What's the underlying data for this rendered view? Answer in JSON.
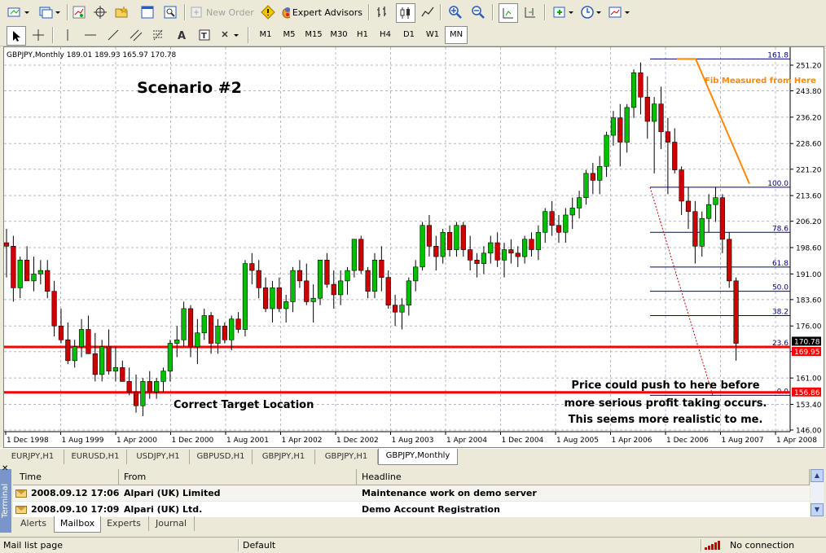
{
  "toolbar": {
    "new_order_label": "New Order",
    "expert_advisors_label": "Expert Advisors"
  },
  "timeframes": [
    "M1",
    "M5",
    "M15",
    "M30",
    "H1",
    "H4",
    "D1",
    "W1",
    "MN"
  ],
  "active_timeframe": "MN",
  "chart": {
    "header": "GBPJPY,Monthly  189.01 189.93 165.97 170.78",
    "annotation_title": "Scenario #2",
    "annotation_target": "Correct Target Location",
    "annotation_fib": "Fib Measured from Here",
    "annotation_note_1": "Price could push to here before",
    "annotation_note_2": "more serious profit taking occurs.",
    "annotation_note_3": "This seems more realistic to me.",
    "colors": {
      "bull": "#00c000",
      "bear": "#d00000",
      "fib": "#000080",
      "trend": "#ff8800",
      "hline": "#ff0000",
      "grid": "#b0b8c8"
    }
  },
  "chart_data": {
    "type": "candlestick",
    "symbol": "GBPJPY",
    "timeframe": "Monthly",
    "ohlc_header": {
      "open": 189.01,
      "high": 189.93,
      "low": 165.97,
      "close": 170.78
    },
    "y_ticks": [
      251.2,
      243.8,
      236.2,
      228.6,
      221.2,
      213.6,
      206.2,
      198.6,
      191.0,
      183.6,
      176.0,
      168.6,
      161.0,
      153.4,
      146.0
    ],
    "ylim": [
      146.0,
      251.2
    ],
    "x_ticks": [
      "1 Dec 1998",
      "1 Aug 1999",
      "1 Apr 2000",
      "1 Dec 2000",
      "1 Aug 2001",
      "1 Apr 2002",
      "1 Dec 2002",
      "1 Aug 2003",
      "1 Apr 2004",
      "1 Dec 2004",
      "1 Aug 2005",
      "1 Apr 2006",
      "1 Dec 2006",
      "1 Aug 2007",
      "1 Apr 2008"
    ],
    "fib_levels": [
      {
        "label": "161.8",
        "price": 253.0
      },
      {
        "label": "100.0",
        "price": 216.0
      },
      {
        "label": "78.6",
        "price": 203.0
      },
      {
        "label": "61.8",
        "price": 193.0
      },
      {
        "label": "50.0",
        "price": 186.0
      },
      {
        "label": "38.2",
        "price": 179.0
      },
      {
        "label": "23.6",
        "price": 170.0
      },
      {
        "label": "0.0",
        "price": 156.0
      }
    ],
    "horizontal_lines": [
      {
        "price": 170.78,
        "label": "170.78"
      },
      {
        "price": 169.95,
        "label": "169.95"
      },
      {
        "price": 156.86,
        "label": "156.86"
      }
    ],
    "candles": [
      [
        200,
        204,
        190,
        199
      ],
      [
        199,
        202,
        183,
        187
      ],
      [
        187,
        196,
        184,
        195
      ],
      [
        195,
        199,
        189,
        189
      ],
      [
        189,
        196,
        186,
        191
      ],
      [
        191,
        195,
        188,
        192
      ],
      [
        192,
        195,
        184,
        186
      ],
      [
        186,
        189,
        173,
        176
      ],
      [
        176,
        181,
        171,
        172
      ],
      [
        172,
        177,
        165,
        166
      ],
      [
        166,
        172,
        164,
        170
      ],
      [
        170,
        178,
        167,
        175
      ],
      [
        175,
        179,
        168,
        168
      ],
      [
        168,
        174,
        160,
        162
      ],
      [
        162,
        172,
        160,
        170
      ],
      [
        170,
        175,
        162,
        163
      ],
      [
        163,
        170,
        160,
        164
      ],
      [
        164,
        166,
        160,
        160
      ],
      [
        160,
        164,
        156,
        157
      ],
      [
        157,
        162,
        151,
        153
      ],
      [
        153,
        161,
        150,
        160
      ],
      [
        160,
        163,
        155,
        157
      ],
      [
        157,
        161,
        155,
        160
      ],
      [
        160,
        164,
        157,
        163
      ],
      [
        163,
        172,
        160,
        171
      ],
      [
        171,
        176,
        167,
        172
      ],
      [
        172,
        183,
        170,
        181
      ],
      [
        181,
        182,
        167,
        170
      ],
      [
        170,
        178,
        165,
        174
      ],
      [
        174,
        181,
        172,
        179
      ],
      [
        179,
        180,
        168,
        171
      ],
      [
        171,
        178,
        168,
        176
      ],
      [
        176,
        177,
        171,
        172
      ],
      [
        172,
        179,
        169,
        178
      ],
      [
        178,
        180,
        174,
        175
      ],
      [
        175,
        195,
        173,
        194
      ],
      [
        194,
        197,
        188,
        192
      ],
      [
        192,
        195,
        184,
        187
      ],
      [
        187,
        190,
        180,
        181
      ],
      [
        181,
        189,
        177,
        187
      ],
      [
        187,
        190,
        180,
        181
      ],
      [
        181,
        185,
        177,
        183
      ],
      [
        183,
        193,
        180,
        192
      ],
      [
        192,
        195,
        187,
        189
      ],
      [
        189,
        194,
        182,
        183
      ],
      [
        183,
        188,
        177,
        184
      ],
      [
        184,
        195,
        182,
        195
      ],
      [
        195,
        197,
        187,
        188
      ],
      [
        188,
        192,
        181,
        185
      ],
      [
        185,
        192,
        182,
        189
      ],
      [
        189,
        193,
        185,
        192
      ],
      [
        192,
        201,
        190,
        201
      ],
      [
        201,
        202,
        191,
        192
      ],
      [
        192,
        193,
        184,
        186
      ],
      [
        186,
        197,
        184,
        195
      ],
      [
        195,
        199,
        186,
        190
      ],
      [
        190,
        192,
        181,
        182
      ],
      [
        182,
        185,
        176,
        180
      ],
      [
        180,
        184,
        175,
        182
      ],
      [
        182,
        190,
        179,
        189
      ],
      [
        189,
        195,
        186,
        193
      ],
      [
        193,
        206,
        192,
        205
      ],
      [
        205,
        208,
        196,
        199
      ],
      [
        199,
        202,
        192,
        196
      ],
      [
        196,
        204,
        194,
        203
      ],
      [
        203,
        205,
        196,
        198
      ],
      [
        198,
        206,
        196,
        205
      ],
      [
        205,
        206,
        196,
        198
      ],
      [
        198,
        202,
        192,
        195
      ],
      [
        195,
        197,
        190,
        194
      ],
      [
        194,
        199,
        191,
        197
      ],
      [
        197,
        202,
        194,
        200
      ],
      [
        200,
        203,
        193,
        195
      ],
      [
        195,
        200,
        190,
        198
      ],
      [
        198,
        201,
        194,
        197
      ],
      [
        197,
        199,
        193,
        196
      ],
      [
        196,
        202,
        194,
        201
      ],
      [
        201,
        203,
        196,
        198
      ],
      [
        198,
        205,
        195,
        203
      ],
      [
        203,
        210,
        200,
        209
      ],
      [
        209,
        212,
        202,
        205
      ],
      [
        205,
        208,
        200,
        203
      ],
      [
        203,
        210,
        200,
        208
      ],
      [
        208,
        213,
        204,
        210
      ],
      [
        210,
        215,
        207,
        213
      ],
      [
        213,
        221,
        211,
        220
      ],
      [
        220,
        223,
        214,
        218
      ],
      [
        218,
        225,
        214,
        222
      ],
      [
        222,
        232,
        219,
        231
      ],
      [
        231,
        238,
        228,
        236
      ],
      [
        236,
        240,
        222,
        229
      ],
      [
        229,
        240,
        226,
        239
      ],
      [
        239,
        250,
        236,
        249
      ],
      [
        249,
        252,
        237,
        242
      ],
      [
        242,
        248,
        230,
        235
      ],
      [
        235,
        242,
        220,
        240
      ],
      [
        240,
        245,
        227,
        232
      ],
      [
        232,
        236,
        214,
        229
      ],
      [
        229,
        233,
        220,
        221
      ],
      [
        221,
        222,
        208,
        212
      ],
      [
        212,
        216,
        204,
        209
      ],
      [
        209,
        212,
        194,
        199
      ],
      [
        199,
        209,
        196,
        207
      ],
      [
        207,
        214,
        203,
        211
      ],
      [
        211,
        216,
        206,
        213
      ],
      [
        213,
        214,
        197,
        201
      ],
      [
        201,
        203,
        187,
        189
      ],
      [
        189,
        190,
        166,
        171
      ]
    ]
  },
  "chart_tabs": [
    "EURJPY,H1",
    "EURUSD,H1",
    "USDJPY,H1",
    "GBPUSD,H1",
    "GBPJPY,H1",
    "GBPJPY,H1",
    "GBPJPY,Monthly"
  ],
  "active_chart_tab": "GBPJPY,Monthly",
  "terminal": {
    "side_label": "Terminal",
    "columns": [
      "Time",
      "From",
      "Headline"
    ],
    "rows": [
      {
        "time": "2008.09.12 17:06",
        "from": "Alpari (UK) Limited",
        "headline": "Maintenance work on demo server"
      },
      {
        "time": "2008.09.10 17:09",
        "from": "Alpari (UK) Ltd.",
        "headline": "Demo Account Registration"
      }
    ],
    "tabs": [
      "Alerts",
      "Mailbox",
      "Experts",
      "Journal"
    ],
    "active_tab": "Mailbox"
  },
  "status": {
    "left": "Mail list page",
    "profile": "Default",
    "connection": "No connection"
  }
}
